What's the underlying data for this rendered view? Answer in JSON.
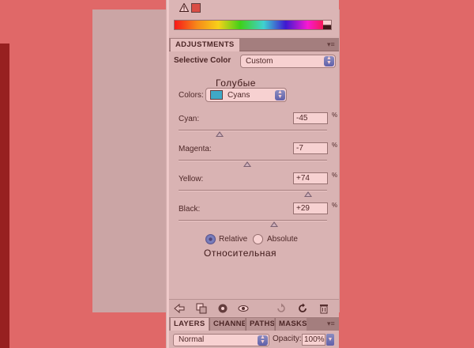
{
  "adjustments_tab": "ADJUSTMENTS",
  "selective_color": {
    "title": "Selective Color",
    "preset": "Custom"
  },
  "colors": {
    "label": "Colors:",
    "value": "Cyans",
    "swatch_color": "#00c8f0"
  },
  "annotations": {
    "cyan_ru": "Голубые",
    "relative_ru": "Относительная"
  },
  "sliders": [
    {
      "label": "Cyan:",
      "value": "-45",
      "unit": "%",
      "level": -45
    },
    {
      "label": "Magenta:",
      "value": "-7",
      "unit": "%",
      "level": -7
    },
    {
      "label": "Yellow:",
      "value": "+74",
      "unit": "%",
      "level": 74
    },
    {
      "label": "Black:",
      "value": "+29",
      "unit": "%",
      "level": 29
    }
  ],
  "method": {
    "relative": "Relative",
    "absolute": "Absolute",
    "selected": "relative"
  },
  "bottom_icons": [
    "back-arrow-icon",
    "clip-layer-icon",
    "visibility-eye-icon",
    "view-previous-icon",
    "reset-icon",
    "trash-icon"
  ],
  "layers_tabs": [
    "LAYERS",
    "CHANNELS",
    "PATHS",
    "MASKS"
  ],
  "blend": {
    "mode": "Normal",
    "opacity_label": "Opacity:",
    "opacity_value": "100%"
  }
}
